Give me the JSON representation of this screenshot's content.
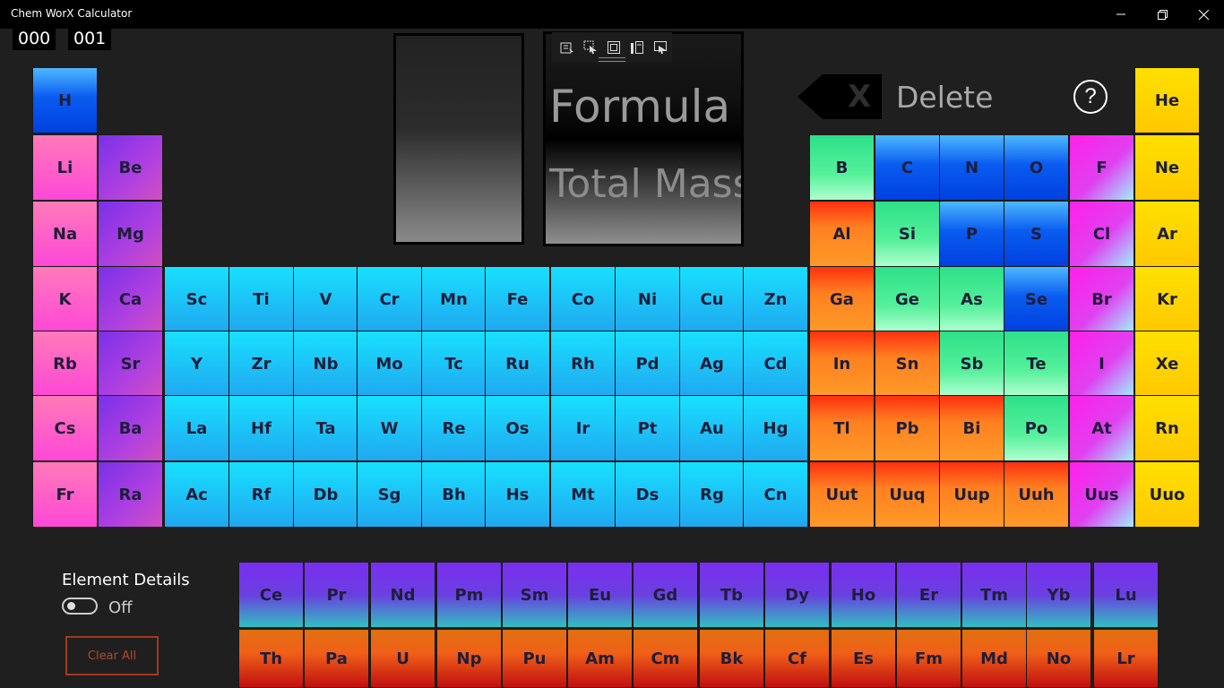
{
  "window": {
    "title": "Chem WorX Calculator"
  },
  "counters": {
    "left": "000",
    "right": "001"
  },
  "display": {
    "formula": "Formula",
    "total_mass": "Total Mass"
  },
  "delete_button": {
    "icon_text": "X",
    "label": "Delete"
  },
  "help": {
    "label": "?"
  },
  "element_details": {
    "label": "Element Details",
    "state": "Off"
  },
  "clear_all": {
    "label": "Clear All"
  },
  "colors": {
    "alkali": "#ff5fc0",
    "alkaline_earth": "#a040e0",
    "transition": "#20b0f0",
    "lanthanide": "#8040e0",
    "actinide": "#e04010",
    "metal": "#f07018",
    "metalloid": "#40e080",
    "nonmetal": "#1060f0",
    "halogen": "#ff30e0",
    "noble_gas": "#ffd000"
  },
  "elements": {
    "main": [
      [
        "H",
        "",
        "",
        "",
        "",
        "",
        "",
        "",
        "",
        "",
        "",
        "",
        "",
        "",
        "",
        "",
        "",
        "He"
      ],
      [
        "Li",
        "Be",
        "",
        "",
        "",
        "",
        "",
        "",
        "",
        "",
        "",
        "",
        "B",
        "C",
        "N",
        "O",
        "F",
        "Ne"
      ],
      [
        "Na",
        "Mg",
        "",
        "",
        "",
        "",
        "",
        "",
        "",
        "",
        "",
        "",
        "Al",
        "Si",
        "P",
        "S",
        "Cl",
        "Ar"
      ],
      [
        "K",
        "Ca",
        "Sc",
        "Ti",
        "V",
        "Cr",
        "Mn",
        "Fe",
        "Co",
        "Ni",
        "Cu",
        "Zn",
        "Ga",
        "Ge",
        "As",
        "Se",
        "Br",
        "Kr"
      ],
      [
        "Rb",
        "Sr",
        "Y",
        "Zr",
        "Nb",
        "Mo",
        "Tc",
        "Ru",
        "Rh",
        "Pd",
        "Ag",
        "Cd",
        "In",
        "Sn",
        "Sb",
        "Te",
        "I",
        "Xe"
      ],
      [
        "Cs",
        "Ba",
        "La",
        "Hf",
        "Ta",
        "W",
        "Re",
        "Os",
        "Ir",
        "Pt",
        "Au",
        "Hg",
        "Tl",
        "Pb",
        "Bi",
        "Po",
        "At",
        "Rn"
      ],
      [
        "Fr",
        "Ra",
        "Ac",
        "Rf",
        "Db",
        "Sg",
        "Bh",
        "Hs",
        "Mt",
        "Ds",
        "Rg",
        "Cn",
        "Uut",
        "Uuq",
        "Uup",
        "Uuh",
        "Uus",
        "Uuo"
      ]
    ],
    "lanthanides": [
      "Ce",
      "Pr",
      "Nd",
      "Pm",
      "Sm",
      "Eu",
      "Gd",
      "Tb",
      "Dy",
      "Ho",
      "Er",
      "Tm",
      "Yb",
      "Lu"
    ],
    "actinides": [
      "Th",
      "Pa",
      "U",
      "Np",
      "Pu",
      "Am",
      "Cm",
      "Bk",
      "Cf",
      "Es",
      "Fm",
      "Md",
      "No",
      "Lr"
    ]
  }
}
